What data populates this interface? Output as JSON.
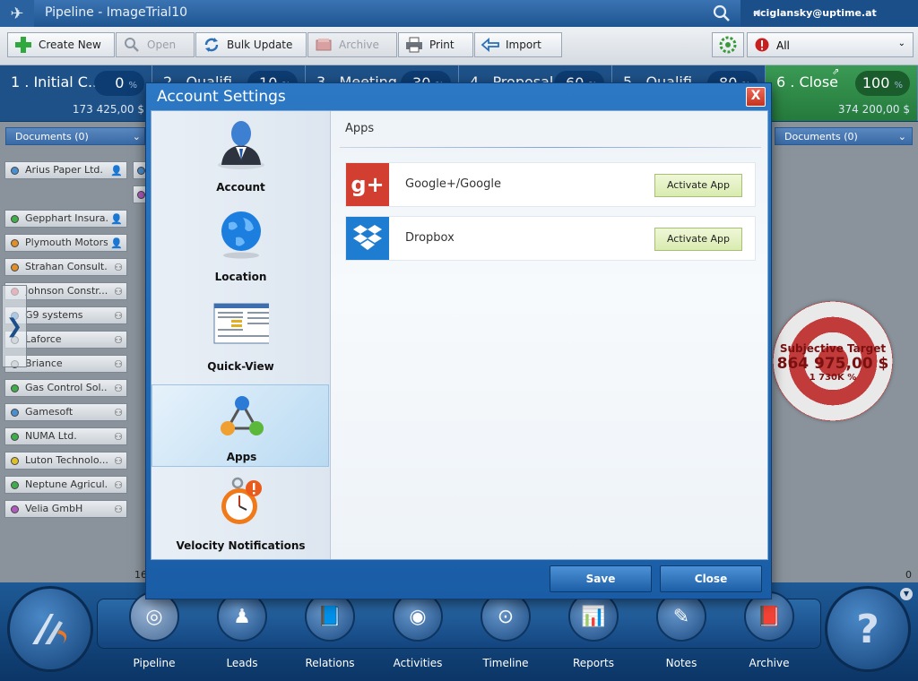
{
  "window": {
    "title": "Pipeline - ImageTrial10",
    "user": "r.ciglansky@uptime.at"
  },
  "toolbar": {
    "create_new": "Create New",
    "open": "Open",
    "bulk_update": "Bulk Update",
    "archive": "Archive",
    "print": "Print",
    "import": "Import",
    "filter_value": "All"
  },
  "stages": [
    {
      "name": "1 . Initial C...",
      "pct": "0",
      "amount": "173 425,00 $"
    },
    {
      "name": "2 . Qualifi...",
      "pct": "10",
      "amount": ""
    },
    {
      "name": "3 . Meeting",
      "pct": "30",
      "amount": ""
    },
    {
      "name": "4 . Proposal",
      "pct": "60",
      "amount": ""
    },
    {
      "name": "5 . Qualifi...",
      "pct": "80",
      "amount": ""
    },
    {
      "name": "6 . Close",
      "pct": "100",
      "amount": "374 200,00 $"
    }
  ],
  "pct_unit": "%",
  "board": {
    "documents_left": "Documents (0)",
    "documents_right": "Documents (0)",
    "cards": [
      {
        "label": "Arius Paper Ltd.",
        "color": "#4a8fd0",
        "type": "person"
      },
      {
        "label": "Gepphart Insura...",
        "color": "#3fae4a",
        "type": "person"
      },
      {
        "label": "Plymouth Motors",
        "color": "#e0902a",
        "type": "person"
      },
      {
        "label": "Strahan Consult...",
        "color": "#e0902a",
        "type": "org"
      },
      {
        "label": "Johnson Constr...",
        "color": "#e05a6a",
        "type": "org"
      },
      {
        "label": "G9 systems",
        "color": "#4a8fd0",
        "type": "org"
      },
      {
        "label": "Laforce",
        "color": "#aab3bc",
        "type": "org"
      },
      {
        "label": "Briance",
        "color": "#aab3bc",
        "type": "org"
      },
      {
        "label": "Gas Control Sol...",
        "color": "#3fae4a",
        "type": "org"
      },
      {
        "label": "Gamesoft",
        "color": "#4a8fd0",
        "type": "org"
      },
      {
        "label": "NUMA Ltd.",
        "color": "#3fae4a",
        "type": "org"
      },
      {
        "label": "Luton Technolo...",
        "color": "#e0c02a",
        "type": "org"
      },
      {
        "label": "Neptune Agricul...",
        "color": "#3fae4a",
        "type": "org"
      },
      {
        "label": "Velia GmbH",
        "color": "#b05ac0",
        "type": "org"
      }
    ],
    "count_left": "16",
    "count_right": "0",
    "target": {
      "title": "Subjective Target",
      "amount": "864 975,00 $",
      "pct": "1 730K %"
    }
  },
  "modal": {
    "title": "Account Settings",
    "close_glyph": "X",
    "nav": [
      {
        "label": "Account",
        "icon": "account-icon"
      },
      {
        "label": "Location",
        "icon": "globe-icon"
      },
      {
        "label": "Quick-View",
        "icon": "quickview-icon"
      },
      {
        "label": "Apps",
        "icon": "apps-icon"
      },
      {
        "label": "Velocity Notifications",
        "icon": "stopwatch-icon"
      }
    ],
    "section_title": "Apps",
    "apps": [
      {
        "name": "Google+/Google",
        "button": "Activate App",
        "icon": "google-plus-icon",
        "color": "#d23f31",
        "glyph": "g+"
      },
      {
        "name": "Dropbox",
        "button": "Activate App",
        "icon": "dropbox-icon",
        "color": "#1f7dd1",
        "glyph": ""
      }
    ],
    "save": "Save",
    "close": "Close"
  },
  "nav": [
    {
      "label": "Pipeline",
      "icon": "pipeline-icon"
    },
    {
      "label": "Leads",
      "icon": "leads-icon"
    },
    {
      "label": "Relations",
      "icon": "relations-icon"
    },
    {
      "label": "Activities",
      "icon": "activities-icon"
    },
    {
      "label": "Timeline",
      "icon": "timeline-icon"
    },
    {
      "label": "Reports",
      "icon": "reports-icon"
    },
    {
      "label": "Notes",
      "icon": "notes-icon"
    },
    {
      "label": "Archive",
      "icon": "archive-icon"
    }
  ],
  "help_glyph": "?"
}
